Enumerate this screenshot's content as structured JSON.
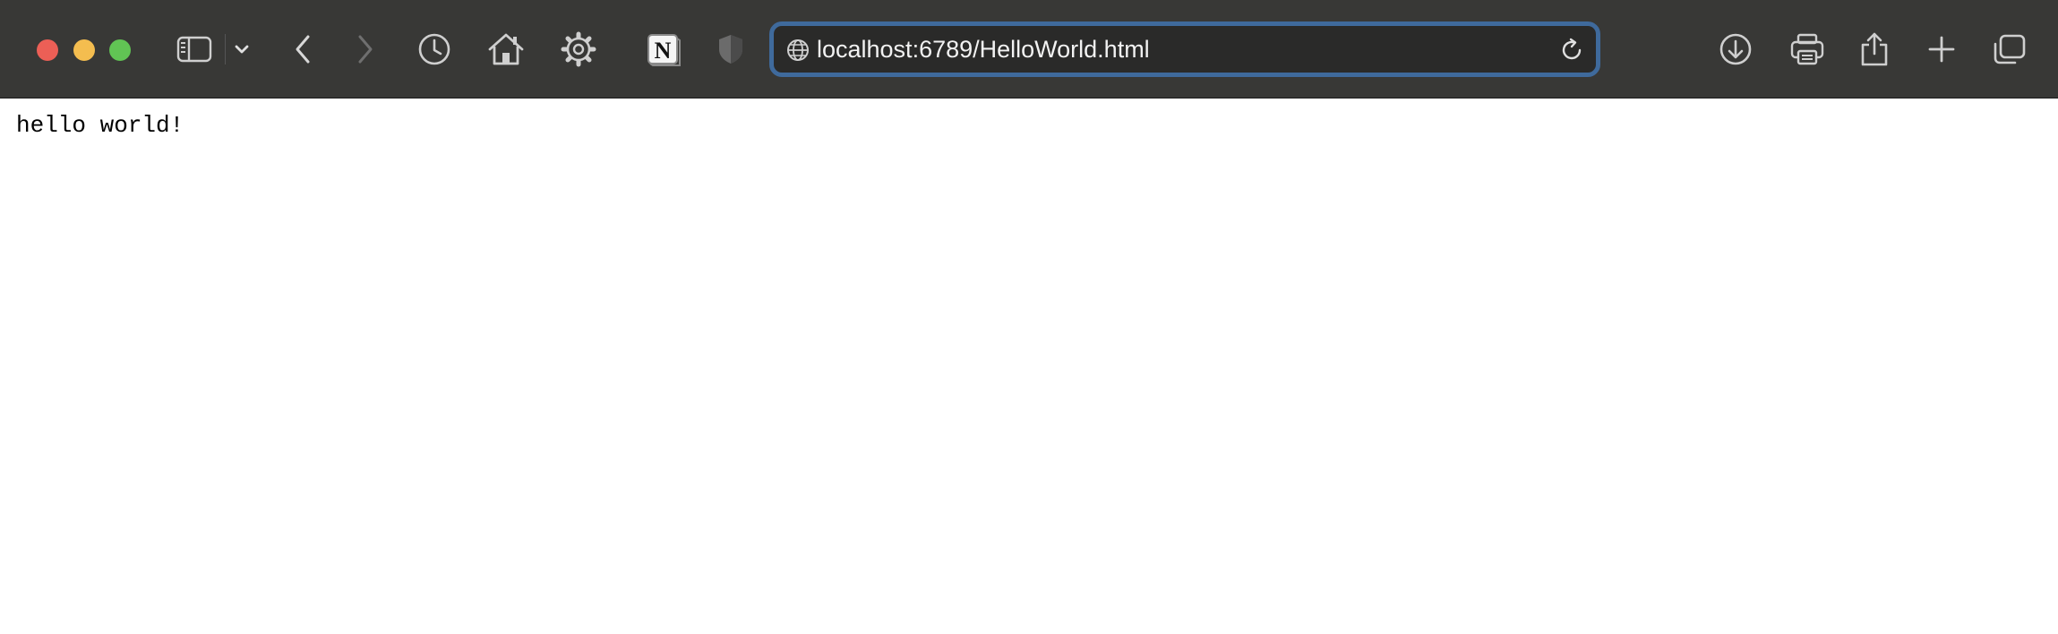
{
  "browser": {
    "window_controls": {
      "close_color": "#ec5f56",
      "minimize_color": "#f4bd4f",
      "maximize_color": "#61c454"
    },
    "toolbar": {
      "icons": [
        "sidebar-icon",
        "chevron-down-icon",
        "back-icon",
        "forward-icon",
        "history-icon",
        "home-icon",
        "gear-icon",
        "notion-icon",
        "shield-icon",
        "download-icon",
        "print-icon",
        "share-icon",
        "new-tab-icon",
        "tab-overview-icon"
      ],
      "notion_letter": "N",
      "accent_color": "#3f6a9c"
    },
    "address_bar": {
      "url": "localhost:6789/HelloWorld.html"
    }
  },
  "page": {
    "text": "hello world!"
  }
}
